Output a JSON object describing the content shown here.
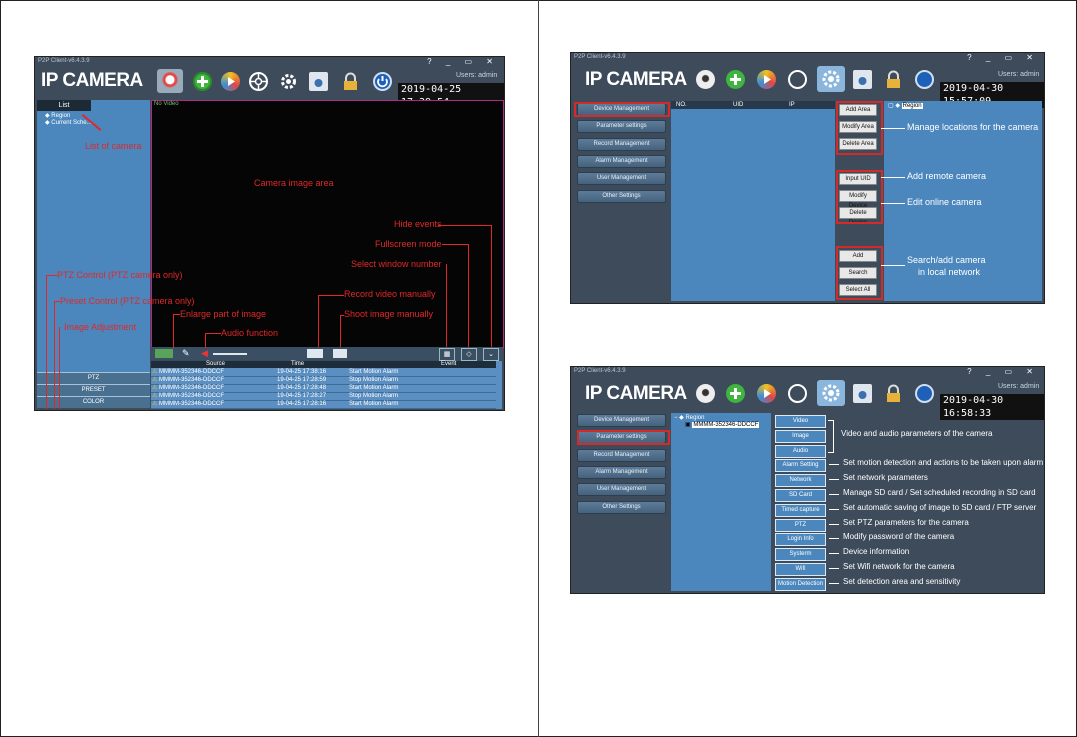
{
  "left": {
    "app_title": "P2P Client-v6.4.3.9",
    "window_controls": "? _ ▭ ✕",
    "brand": "IP CAMERA",
    "users": "Users: admin",
    "clock": "2019-04-25 17:39:54",
    "list_tab": "List",
    "tree": [
      "Region",
      "Current Sche..."
    ],
    "video_title": "No Video",
    "side_tabs": [
      "PTZ",
      "PRESET",
      "COLOR"
    ],
    "events": {
      "headers": [
        "Source",
        "Time",
        "Event"
      ],
      "rows": [
        [
          "MMMM-352346-DDCCF",
          "19-04-25 17:38:16",
          "Start Motion Alarm"
        ],
        [
          "MMMM-352346-DDCCF",
          "19-04-25 17:28:59",
          "Stop Motion Alarm"
        ],
        [
          "MMMM-352346-DDCCF",
          "19-04-25 17:28:48",
          "Start Motion Alarm"
        ],
        [
          "MMMM-352346-DDCCF",
          "19-04-25 17:28:27",
          "Stop Motion Alarm"
        ],
        [
          "MMMM-352346-DDCCF",
          "19-04-25 17:28:16",
          "Start Motion Alarm"
        ]
      ]
    },
    "annotations": {
      "list_of_camera": "List of camera",
      "camera_image_area": "Camera image area",
      "hide_events": "Hide events",
      "fullscreen_mode": "Fullscreen mode",
      "select_window_number": "Select window number",
      "ptz_control": "PTZ Control (PTZ camera only)",
      "record_video": "Record video manually",
      "preset_control": "Preset Control (PTZ camera only)",
      "enlarge": "Enlarge part of image",
      "shoot_image": "Shoot image manually",
      "image_adjustment": "Image Adjustment",
      "audio_function": "Audio function"
    }
  },
  "top_right": {
    "app_title": "P2P Client-v6.4.3.9",
    "window_controls": "? _ ▭ ✕",
    "brand": "IP CAMERA",
    "users": "Users: admin",
    "clock": "2019-04-30 15:57:09",
    "nav": [
      "Device Management",
      "Parameter settings",
      "Record Management",
      "Alarm Management",
      "User Management",
      "Other Settings"
    ],
    "table_headers": [
      "NO.",
      "UID",
      "IP"
    ],
    "buttons": [
      "Add Area",
      "Modify Area",
      "Delete Area",
      "Input UID",
      "Modify Device",
      "Delete Device",
      "Add",
      "Search",
      "Select All"
    ],
    "tree_root": "Region",
    "annotations": {
      "manage_locations": "Manage locations for the camera",
      "add_remote": "Add remote camera",
      "edit_online": "Edit online camera",
      "search_add_1": "Search/add camera",
      "search_add_2": "in local network"
    }
  },
  "bottom_right": {
    "app_title": "P2P Client-v6.4.3.9",
    "window_controls": "? _ ▭ ✕",
    "brand": "IP CAMERA",
    "users": "Users: admin",
    "clock": "2019-04-30 16:58:33",
    "nav": [
      "Device Management",
      "Parameter settings",
      "Record Management",
      "Alarm Management",
      "User Management",
      "Other Settings"
    ],
    "tree_root": "Region",
    "tree_child": "MMMM-352346-DDCCF",
    "buttons": [
      "Video",
      "Image",
      "Audio",
      "Alarm Setting",
      "Network",
      "SD Card",
      "Timed capture",
      "PTZ",
      "Login Info",
      "Systerm",
      "Wifi",
      "Motion Detection"
    ],
    "descriptions": {
      "video_image_audio": "Video and audio parameters of the camera",
      "alarm": "Set motion detection and actions to be taken upon alarm",
      "network": "Set network parameters",
      "sd_card": "Manage SD card / Set scheduled recording in SD card",
      "timed_capture": "Set automatic saving of image to SD card / FTP server",
      "ptz": "Set PTZ parameters for the camera",
      "login_info": "Modify password of the camera",
      "system": "Device information",
      "wifi": "Set Wifi network for the camera",
      "motion": "Set detection area and sensitivity"
    }
  }
}
